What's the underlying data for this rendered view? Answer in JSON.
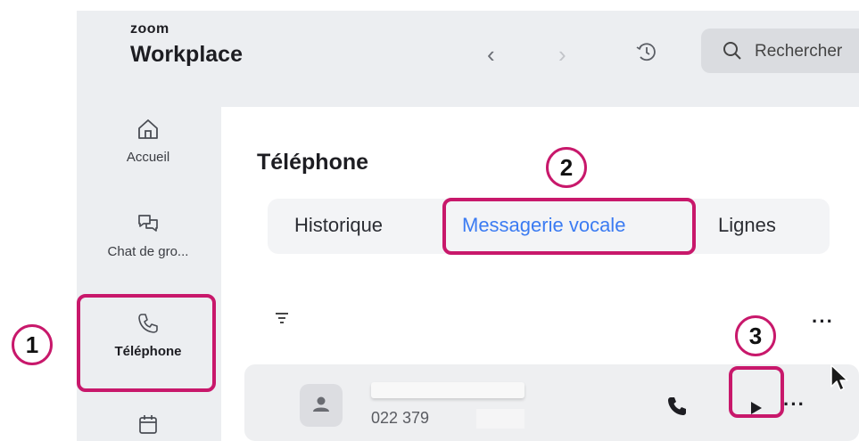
{
  "header": {
    "brand_small": "zoom",
    "brand_big": "Workplace",
    "back_glyph": "‹",
    "forward_glyph": "›",
    "history_icon": "history-clock-icon",
    "search_placeholder": "Rechercher"
  },
  "sidebar": {
    "items": [
      {
        "label": "Accueil",
        "icon": "home-icon"
      },
      {
        "label": "Chat de gro...",
        "icon": "chat-icon"
      },
      {
        "label": "Téléphone",
        "icon": "phone-icon",
        "active": true
      },
      {
        "label": "",
        "icon": "calendar-icon"
      }
    ]
  },
  "main": {
    "title": "Téléphone",
    "tabs": [
      {
        "label": "Historique"
      },
      {
        "label": "Messagerie vocale",
        "active": true
      },
      {
        "label": "Lignes"
      }
    ],
    "more_glyph": "···",
    "voicemail": {
      "number": "022 379"
    }
  },
  "annotations": {
    "step1": "1",
    "step2": "2",
    "step3": "3",
    "highlight_color": "#c8186b"
  },
  "colors": {
    "accent": "#3b7bf2",
    "sidebar_bg": "#eceef1"
  }
}
